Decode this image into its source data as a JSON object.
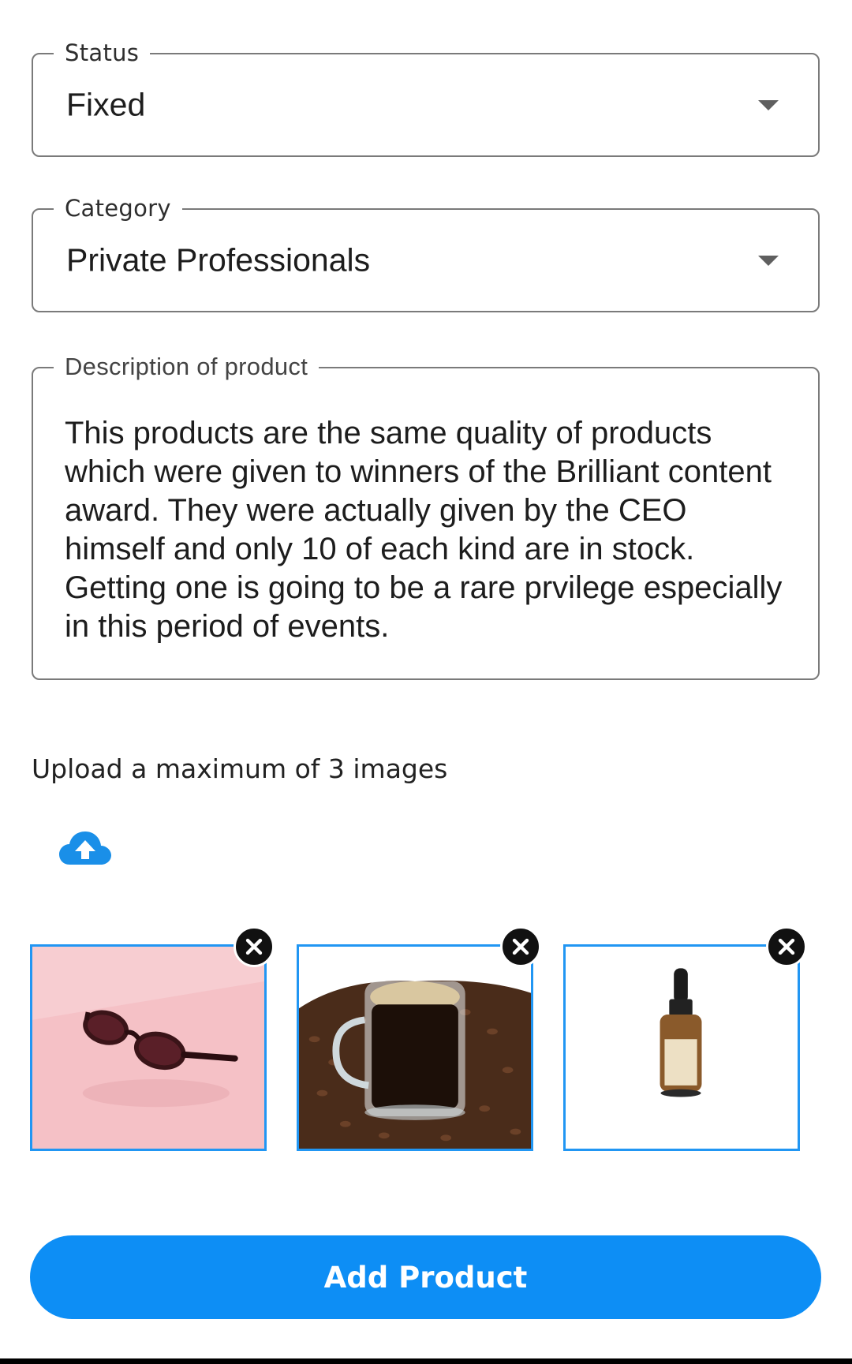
{
  "status_field": {
    "legend": "Status",
    "value": "Fixed"
  },
  "category_field": {
    "legend": "Category",
    "value": "Private Professionals"
  },
  "description_field": {
    "legend": "Description of product",
    "value": "This products are the same quality of products which were given to winners of the Brilliant content award. They were actually given by the CEO himself and only 10 of each kind are in stock. Getting one is going to be a rare prvilege especially in this period of events."
  },
  "upload": {
    "label": "Upload a maximum of 3 images",
    "icon": "cloud-upload-icon",
    "images": [
      {
        "subject": "sunglasses",
        "icon": "close-icon"
      },
      {
        "subject": "coffee cup on coffee beans",
        "icon": "close-icon"
      },
      {
        "subject": "dropper bottle",
        "icon": "close-icon"
      }
    ]
  },
  "actions": {
    "submit_label": "Add Product"
  },
  "colors": {
    "accent": "#0d8ef5",
    "thumb_border": "#2196f3",
    "outline": "#7a7a7a"
  }
}
